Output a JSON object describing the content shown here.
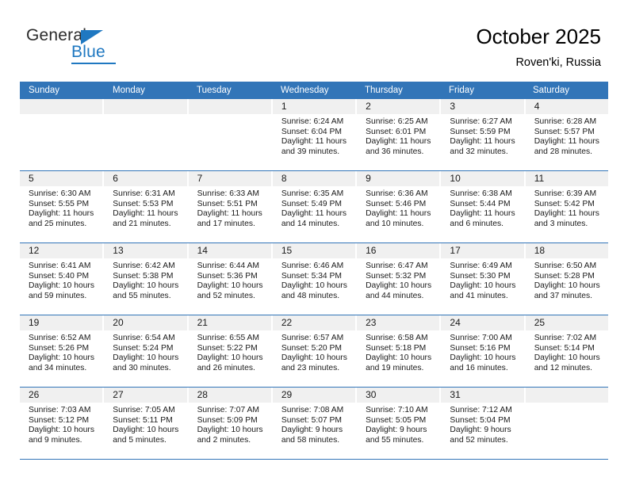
{
  "brand": {
    "name_part1": "General",
    "name_part2": "Blue",
    "logo_icon": "blue-triangle-flag"
  },
  "header": {
    "title": "October 2025",
    "subtitle": "Roven'ki, Russia"
  },
  "colors": {
    "header_blue": "#3275b8",
    "daynum_band": "#f0f0f0",
    "brand_blue": "#1f78c1",
    "text": "#1a1a1a"
  },
  "weekdays": [
    "Sunday",
    "Monday",
    "Tuesday",
    "Wednesday",
    "Thursday",
    "Friday",
    "Saturday"
  ],
  "weeks": [
    [
      {
        "day": "",
        "sunrise": "",
        "sunset": "",
        "daylight": ""
      },
      {
        "day": "",
        "sunrise": "",
        "sunset": "",
        "daylight": ""
      },
      {
        "day": "",
        "sunrise": "",
        "sunset": "",
        "daylight": ""
      },
      {
        "day": "1",
        "sunrise": "Sunrise: 6:24 AM",
        "sunset": "Sunset: 6:04 PM",
        "daylight": "Daylight: 11 hours and 39 minutes."
      },
      {
        "day": "2",
        "sunrise": "Sunrise: 6:25 AM",
        "sunset": "Sunset: 6:01 PM",
        "daylight": "Daylight: 11 hours and 36 minutes."
      },
      {
        "day": "3",
        "sunrise": "Sunrise: 6:27 AM",
        "sunset": "Sunset: 5:59 PM",
        "daylight": "Daylight: 11 hours and 32 minutes."
      },
      {
        "day": "4",
        "sunrise": "Sunrise: 6:28 AM",
        "sunset": "Sunset: 5:57 PM",
        "daylight": "Daylight: 11 hours and 28 minutes."
      }
    ],
    [
      {
        "day": "5",
        "sunrise": "Sunrise: 6:30 AM",
        "sunset": "Sunset: 5:55 PM",
        "daylight": "Daylight: 11 hours and 25 minutes."
      },
      {
        "day": "6",
        "sunrise": "Sunrise: 6:31 AM",
        "sunset": "Sunset: 5:53 PM",
        "daylight": "Daylight: 11 hours and 21 minutes."
      },
      {
        "day": "7",
        "sunrise": "Sunrise: 6:33 AM",
        "sunset": "Sunset: 5:51 PM",
        "daylight": "Daylight: 11 hours and 17 minutes."
      },
      {
        "day": "8",
        "sunrise": "Sunrise: 6:35 AM",
        "sunset": "Sunset: 5:49 PM",
        "daylight": "Daylight: 11 hours and 14 minutes."
      },
      {
        "day": "9",
        "sunrise": "Sunrise: 6:36 AM",
        "sunset": "Sunset: 5:46 PM",
        "daylight": "Daylight: 11 hours and 10 minutes."
      },
      {
        "day": "10",
        "sunrise": "Sunrise: 6:38 AM",
        "sunset": "Sunset: 5:44 PM",
        "daylight": "Daylight: 11 hours and 6 minutes."
      },
      {
        "day": "11",
        "sunrise": "Sunrise: 6:39 AM",
        "sunset": "Sunset: 5:42 PM",
        "daylight": "Daylight: 11 hours and 3 minutes."
      }
    ],
    [
      {
        "day": "12",
        "sunrise": "Sunrise: 6:41 AM",
        "sunset": "Sunset: 5:40 PM",
        "daylight": "Daylight: 10 hours and 59 minutes."
      },
      {
        "day": "13",
        "sunrise": "Sunrise: 6:42 AM",
        "sunset": "Sunset: 5:38 PM",
        "daylight": "Daylight: 10 hours and 55 minutes."
      },
      {
        "day": "14",
        "sunrise": "Sunrise: 6:44 AM",
        "sunset": "Sunset: 5:36 PM",
        "daylight": "Daylight: 10 hours and 52 minutes."
      },
      {
        "day": "15",
        "sunrise": "Sunrise: 6:46 AM",
        "sunset": "Sunset: 5:34 PM",
        "daylight": "Daylight: 10 hours and 48 minutes."
      },
      {
        "day": "16",
        "sunrise": "Sunrise: 6:47 AM",
        "sunset": "Sunset: 5:32 PM",
        "daylight": "Daylight: 10 hours and 44 minutes."
      },
      {
        "day": "17",
        "sunrise": "Sunrise: 6:49 AM",
        "sunset": "Sunset: 5:30 PM",
        "daylight": "Daylight: 10 hours and 41 minutes."
      },
      {
        "day": "18",
        "sunrise": "Sunrise: 6:50 AM",
        "sunset": "Sunset: 5:28 PM",
        "daylight": "Daylight: 10 hours and 37 minutes."
      }
    ],
    [
      {
        "day": "19",
        "sunrise": "Sunrise: 6:52 AM",
        "sunset": "Sunset: 5:26 PM",
        "daylight": "Daylight: 10 hours and 34 minutes."
      },
      {
        "day": "20",
        "sunrise": "Sunrise: 6:54 AM",
        "sunset": "Sunset: 5:24 PM",
        "daylight": "Daylight: 10 hours and 30 minutes."
      },
      {
        "day": "21",
        "sunrise": "Sunrise: 6:55 AM",
        "sunset": "Sunset: 5:22 PM",
        "daylight": "Daylight: 10 hours and 26 minutes."
      },
      {
        "day": "22",
        "sunrise": "Sunrise: 6:57 AM",
        "sunset": "Sunset: 5:20 PM",
        "daylight": "Daylight: 10 hours and 23 minutes."
      },
      {
        "day": "23",
        "sunrise": "Sunrise: 6:58 AM",
        "sunset": "Sunset: 5:18 PM",
        "daylight": "Daylight: 10 hours and 19 minutes."
      },
      {
        "day": "24",
        "sunrise": "Sunrise: 7:00 AM",
        "sunset": "Sunset: 5:16 PM",
        "daylight": "Daylight: 10 hours and 16 minutes."
      },
      {
        "day": "25",
        "sunrise": "Sunrise: 7:02 AM",
        "sunset": "Sunset: 5:14 PM",
        "daylight": "Daylight: 10 hours and 12 minutes."
      }
    ],
    [
      {
        "day": "26",
        "sunrise": "Sunrise: 7:03 AM",
        "sunset": "Sunset: 5:12 PM",
        "daylight": "Daylight: 10 hours and 9 minutes."
      },
      {
        "day": "27",
        "sunrise": "Sunrise: 7:05 AM",
        "sunset": "Sunset: 5:11 PM",
        "daylight": "Daylight: 10 hours and 5 minutes."
      },
      {
        "day": "28",
        "sunrise": "Sunrise: 7:07 AM",
        "sunset": "Sunset: 5:09 PM",
        "daylight": "Daylight: 10 hours and 2 minutes."
      },
      {
        "day": "29",
        "sunrise": "Sunrise: 7:08 AM",
        "sunset": "Sunset: 5:07 PM",
        "daylight": "Daylight: 9 hours and 58 minutes."
      },
      {
        "day": "30",
        "sunrise": "Sunrise: 7:10 AM",
        "sunset": "Sunset: 5:05 PM",
        "daylight": "Daylight: 9 hours and 55 minutes."
      },
      {
        "day": "31",
        "sunrise": "Sunrise: 7:12 AM",
        "sunset": "Sunset: 5:04 PM",
        "daylight": "Daylight: 9 hours and 52 minutes."
      },
      {
        "day": "",
        "sunrise": "",
        "sunset": "",
        "daylight": ""
      }
    ]
  ]
}
